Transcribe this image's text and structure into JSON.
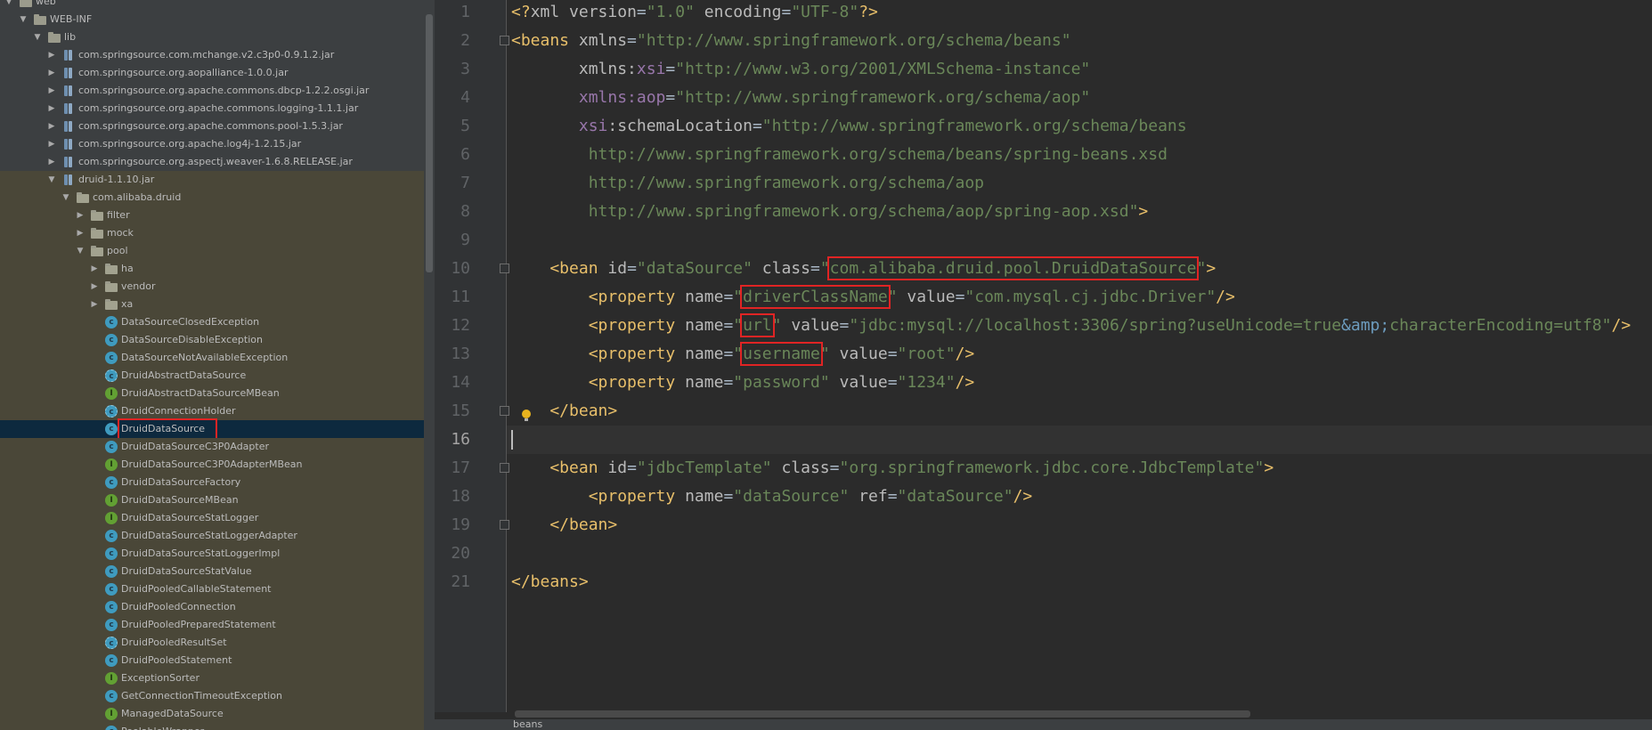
{
  "tree": {
    "rows": [
      {
        "label": "web",
        "depth": 1,
        "arrow": "open",
        "icon": "folder-icon"
      },
      {
        "label": "WEB-INF",
        "depth": 2,
        "arrow": "open",
        "icon": "folder-icon"
      },
      {
        "label": "lib",
        "depth": 3,
        "arrow": "open",
        "icon": "folder-icon"
      },
      {
        "label": "com.springsource.com.mchange.v2.c3p0-0.9.1.2.jar",
        "depth": 4,
        "arrow": "closed",
        "icon": "jar-icon"
      },
      {
        "label": "com.springsource.org.aopalliance-1.0.0.jar",
        "depth": 4,
        "arrow": "closed",
        "icon": "jar-icon"
      },
      {
        "label": "com.springsource.org.apache.commons.dbcp-1.2.2.osgi.jar",
        "depth": 4,
        "arrow": "closed",
        "icon": "jar-icon"
      },
      {
        "label": "com.springsource.org.apache.commons.logging-1.1.1.jar",
        "depth": 4,
        "arrow": "closed",
        "icon": "jar-icon"
      },
      {
        "label": "com.springsource.org.apache.commons.pool-1.5.3.jar",
        "depth": 4,
        "arrow": "closed",
        "icon": "jar-icon"
      },
      {
        "label": "com.springsource.org.apache.log4j-1.2.15.jar",
        "depth": 4,
        "arrow": "closed",
        "icon": "jar-icon"
      },
      {
        "label": "com.springsource.org.aspectj.weaver-1.6.8.RELEASE.jar",
        "depth": 4,
        "arrow": "closed",
        "icon": "jar-icon"
      },
      {
        "label": "druid-1.1.10.jar",
        "depth": 4,
        "arrow": "open",
        "icon": "jar-icon"
      },
      {
        "label": "com.alibaba.druid",
        "depth": 5,
        "arrow": "open",
        "icon": "package-icon"
      },
      {
        "label": "filter",
        "depth": 6,
        "arrow": "closed",
        "icon": "package-icon"
      },
      {
        "label": "mock",
        "depth": 6,
        "arrow": "closed",
        "icon": "package-icon"
      },
      {
        "label": "pool",
        "depth": 6,
        "arrow": "open",
        "icon": "package-icon"
      },
      {
        "label": "ha",
        "depth": 7,
        "arrow": "closed",
        "icon": "package-icon"
      },
      {
        "label": "vendor",
        "depth": 7,
        "arrow": "closed",
        "icon": "package-icon"
      },
      {
        "label": "xa",
        "depth": 7,
        "arrow": "closed",
        "icon": "package-icon"
      },
      {
        "label": "DataSourceClosedException",
        "depth": 7,
        "arrow": "none",
        "icon": "class-icon"
      },
      {
        "label": "DataSourceDisableException",
        "depth": 7,
        "arrow": "none",
        "icon": "class-icon"
      },
      {
        "label": "DataSourceNotAvailableException",
        "depth": 7,
        "arrow": "none",
        "icon": "class-icon"
      },
      {
        "label": "DruidAbstractDataSource",
        "depth": 7,
        "arrow": "none",
        "icon": "abstract-class-icon"
      },
      {
        "label": "DruidAbstractDataSourceMBean",
        "depth": 7,
        "arrow": "none",
        "icon": "interface-icon"
      },
      {
        "label": "DruidConnectionHolder",
        "depth": 7,
        "arrow": "none",
        "icon": "abstract-class-icon"
      },
      {
        "label": "DruidDataSource",
        "depth": 7,
        "arrow": "none",
        "icon": "class-icon",
        "selected": true,
        "boxed": true
      },
      {
        "label": "DruidDataSourceC3P0Adapter",
        "depth": 7,
        "arrow": "none",
        "icon": "class-icon"
      },
      {
        "label": "DruidDataSourceC3P0AdapterMBean",
        "depth": 7,
        "arrow": "none",
        "icon": "interface-icon"
      },
      {
        "label": "DruidDataSourceFactory",
        "depth": 7,
        "arrow": "none",
        "icon": "class-icon"
      },
      {
        "label": "DruidDataSourceMBean",
        "depth": 7,
        "arrow": "none",
        "icon": "interface-icon"
      },
      {
        "label": "DruidDataSourceStatLogger",
        "depth": 7,
        "arrow": "none",
        "icon": "interface-icon"
      },
      {
        "label": "DruidDataSourceStatLoggerAdapter",
        "depth": 7,
        "arrow": "none",
        "icon": "class-icon"
      },
      {
        "label": "DruidDataSourceStatLoggerImpl",
        "depth": 7,
        "arrow": "none",
        "icon": "class-icon"
      },
      {
        "label": "DruidDataSourceStatValue",
        "depth": 7,
        "arrow": "none",
        "icon": "class-icon"
      },
      {
        "label": "DruidPooledCallableStatement",
        "depth": 7,
        "arrow": "none",
        "icon": "class-icon"
      },
      {
        "label": "DruidPooledConnection",
        "depth": 7,
        "arrow": "none",
        "icon": "class-icon"
      },
      {
        "label": "DruidPooledPreparedStatement",
        "depth": 7,
        "arrow": "none",
        "icon": "class-icon"
      },
      {
        "label": "DruidPooledResultSet",
        "depth": 7,
        "arrow": "none",
        "icon": "abstract-class-icon"
      },
      {
        "label": "DruidPooledStatement",
        "depth": 7,
        "arrow": "none",
        "icon": "class-icon"
      },
      {
        "label": "ExceptionSorter",
        "depth": 7,
        "arrow": "none",
        "icon": "interface-icon"
      },
      {
        "label": "GetConnectionTimeoutException",
        "depth": 7,
        "arrow": "none",
        "icon": "class-icon"
      },
      {
        "label": "ManagedDataSource",
        "depth": 7,
        "arrow": "none",
        "icon": "interface-icon"
      },
      {
        "label": "PoolableWrapper",
        "depth": 7,
        "arrow": "none",
        "icon": "class-icon"
      }
    ]
  },
  "editor": {
    "active_line": 16,
    "lines": [
      [
        [
          "t",
          "<?"
        ],
        [
          "a",
          "xml "
        ],
        [
          "a",
          "version"
        ],
        [
          "e",
          "="
        ],
        [
          "s",
          "\"1.0\""
        ],
        [
          "a",
          " encoding"
        ],
        [
          "e",
          "="
        ],
        [
          "s",
          "\"UTF-8\""
        ],
        [
          "t",
          "?>"
        ]
      ],
      [
        [
          "t",
          "<beans "
        ],
        [
          "a",
          "xmlns"
        ],
        [
          "e",
          "="
        ],
        [
          "s",
          "\"http://www.springframework.org/schema/beans\""
        ]
      ],
      [
        [
          "a",
          "       xmlns:"
        ],
        [
          "ns",
          "xsi"
        ],
        [
          "e",
          "="
        ],
        [
          "s",
          "\"http://www.w3.org/2001/XMLSchema-instance\""
        ]
      ],
      [
        [
          "ns",
          "       xmlns:aop"
        ],
        [
          "e",
          "="
        ],
        [
          "s",
          "\"http://www.springframework.org/schema/aop\""
        ]
      ],
      [
        [
          "ns",
          "       xsi"
        ],
        [
          "a",
          ":schemaLocation"
        ],
        [
          "e",
          "="
        ],
        [
          "s",
          "\"http://www.springframework.org/schema/beans"
        ]
      ],
      [
        [
          "s",
          "        http://www.springframework.org/schema/beans/spring-beans.xsd"
        ]
      ],
      [
        [
          "s",
          "        http://www.springframework.org/schema/aop"
        ]
      ],
      [
        [
          "s",
          "        http://www.springframework.org/schema/aop/spring-aop.xsd\""
        ],
        [
          "t",
          ">"
        ]
      ],
      [],
      [
        [
          "t",
          "    <bean "
        ],
        [
          "a",
          "id"
        ],
        [
          "e",
          "="
        ],
        [
          "s",
          "\"dataSource\""
        ],
        [
          "a",
          " class"
        ],
        [
          "e",
          "="
        ],
        [
          "s",
          "\""
        ],
        [
          "s",
          "com.alibaba.druid.pool.DruidDataSource",
          "hl"
        ],
        [
          "s",
          "\""
        ],
        [
          "t",
          ">"
        ]
      ],
      [
        [
          "t",
          "        <property "
        ],
        [
          "a",
          "name"
        ],
        [
          "e",
          "="
        ],
        [
          "s",
          "\""
        ],
        [
          "s",
          "driverClassName",
          "hl"
        ],
        [
          "s",
          "\""
        ],
        [
          "a",
          " value"
        ],
        [
          "e",
          "="
        ],
        [
          "s",
          "\"com.mysql.cj.jdbc.Driver\""
        ],
        [
          "t",
          "/>"
        ]
      ],
      [
        [
          "t",
          "        <property "
        ],
        [
          "a",
          "name"
        ],
        [
          "e",
          "="
        ],
        [
          "s",
          "\""
        ],
        [
          "s",
          "url",
          "hl"
        ],
        [
          "s",
          "\""
        ],
        [
          "a",
          " value"
        ],
        [
          "e",
          "="
        ],
        [
          "s",
          "\"jdbc:mysql://localhost:3306/spring?useUnicode=true"
        ],
        [
          "ent",
          "&amp;"
        ],
        [
          "s",
          "characterEncoding=utf8\""
        ],
        [
          "t",
          "/>"
        ]
      ],
      [
        [
          "t",
          "        <property "
        ],
        [
          "a",
          "name"
        ],
        [
          "e",
          "="
        ],
        [
          "s",
          "\""
        ],
        [
          "s",
          "username",
          "hl"
        ],
        [
          "s",
          "\""
        ],
        [
          "a",
          " value"
        ],
        [
          "e",
          "="
        ],
        [
          "s",
          "\"root\""
        ],
        [
          "t",
          "/>"
        ]
      ],
      [
        [
          "t",
          "        <property "
        ],
        [
          "a",
          "name"
        ],
        [
          "e",
          "="
        ],
        [
          "s",
          "\"password\""
        ],
        [
          "a",
          " value"
        ],
        [
          "e",
          "="
        ],
        [
          "s",
          "\"1234\""
        ],
        [
          "t",
          "/>"
        ]
      ],
      [
        [
          "t",
          "    </bean>"
        ]
      ],
      [],
      [
        [
          "t",
          "    <bean "
        ],
        [
          "a",
          "id"
        ],
        [
          "e",
          "="
        ],
        [
          "s",
          "\"jdbcTemplate\""
        ],
        [
          "a",
          " class"
        ],
        [
          "e",
          "="
        ],
        [
          "s",
          "\"org.springframework.jdbc.core.JdbcTemplate\""
        ],
        [
          "t",
          ">"
        ]
      ],
      [
        [
          "t",
          "        <property "
        ],
        [
          "a",
          "name"
        ],
        [
          "e",
          "="
        ],
        [
          "s",
          "\"dataSource\""
        ],
        [
          "a",
          " ref"
        ],
        [
          "e",
          "="
        ],
        [
          "s",
          "\"dataSource\""
        ],
        [
          "t",
          "/>"
        ]
      ],
      [
        [
          "t",
          "    </bean>"
        ]
      ],
      [],
      [
        [
          "t",
          "</beans>"
        ]
      ]
    ],
    "fold_markers": [
      2,
      10,
      15,
      17,
      19
    ],
    "breadcrumb": "beans",
    "colors": {
      "tag": "#e8bf6a",
      "attribute": "#bababa",
      "namespace": "#9876aa",
      "string": "#6a8759",
      "entity": "#6d9cbe",
      "highlight_box": "#e02424"
    }
  }
}
